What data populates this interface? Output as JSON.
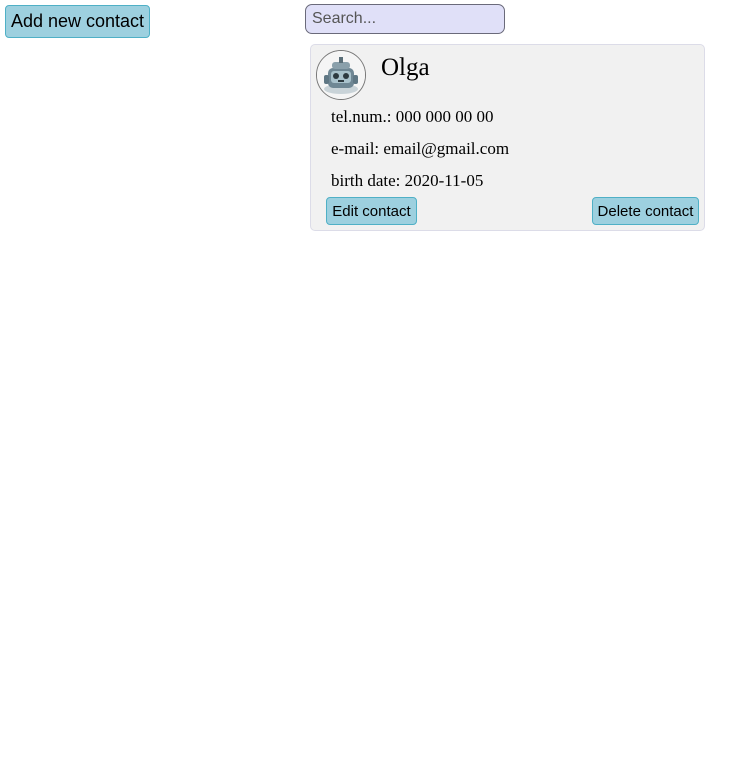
{
  "toolbar": {
    "add_label": "Add new contact"
  },
  "search": {
    "placeholder": "Search...",
    "value": ""
  },
  "contacts": [
    {
      "avatar_icon": "robot-avatar-icon",
      "name": "Olga",
      "tel": "tel.num.: 000 000 00 00",
      "email": "e-mail: email@gmail.com",
      "birth": "birth date: 2020-11-05",
      "edit_label": "Edit contact",
      "delete_label": "Delete contact"
    }
  ],
  "colors": {
    "button_bg": "#9dd0df",
    "button_border": "#4fb0c6",
    "search_bg": "#e0e0f8",
    "card_bg": "#f1f1f1"
  }
}
